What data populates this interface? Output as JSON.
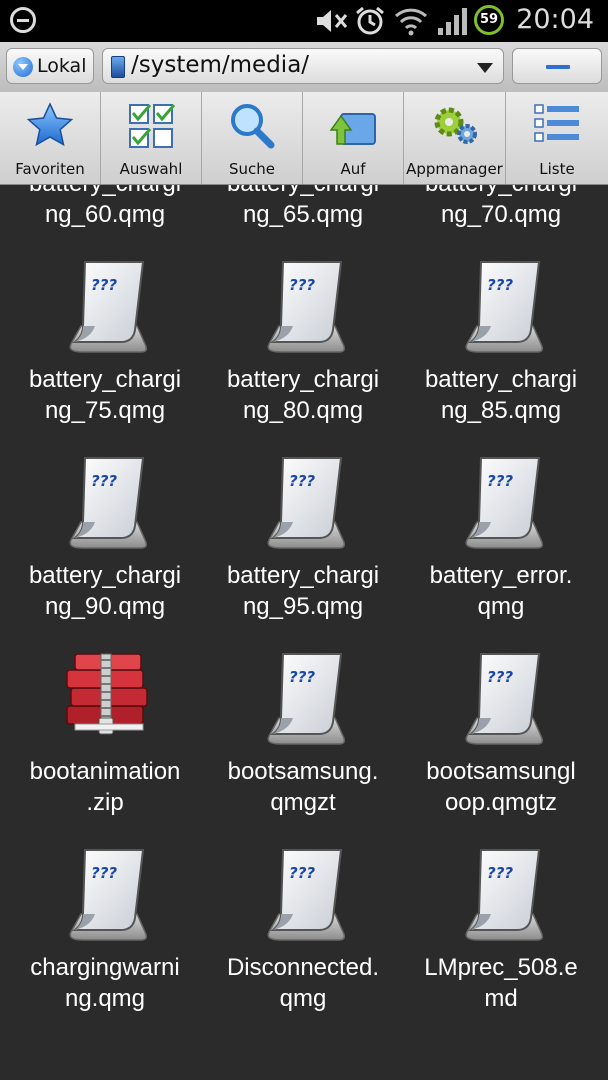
{
  "status_bar": {
    "time": "20:04",
    "battery_level": "59",
    "icons": [
      "do-not-disturb-icon",
      "mute-icon",
      "alarm-icon",
      "wifi-icon",
      "signal-icon",
      "battery-icon"
    ]
  },
  "address_bar": {
    "location_label": "Lokal",
    "path": "/system/media/"
  },
  "toolbar": {
    "items": [
      {
        "label": "Favoriten",
        "icon": "star-icon"
      },
      {
        "label": "Auswahl",
        "icon": "checklist-icon"
      },
      {
        "label": "Suche",
        "icon": "magnifier-icon"
      },
      {
        "label": "Auf",
        "icon": "folder-up-icon"
      },
      {
        "label": "Appmanager",
        "icon": "gears-icon"
      },
      {
        "label": "Liste",
        "icon": "list-view-icon"
      }
    ]
  },
  "files": [
    {
      "line1": "battery_chargi",
      "line2": "ng_60.qmg",
      "type": "unknown"
    },
    {
      "line1": "battery_chargi",
      "line2": "ng_65.qmg",
      "type": "unknown"
    },
    {
      "line1": "battery_chargi",
      "line2": "ng_70.qmg",
      "type": "unknown"
    },
    {
      "line1": "battery_chargi",
      "line2": "ng_75.qmg",
      "type": "unknown"
    },
    {
      "line1": "battery_chargi",
      "line2": "ng_80.qmg",
      "type": "unknown"
    },
    {
      "line1": "battery_chargi",
      "line2": "ng_85.qmg",
      "type": "unknown"
    },
    {
      "line1": "battery_chargi",
      "line2": "ng_90.qmg",
      "type": "unknown"
    },
    {
      "line1": "battery_chargi",
      "line2": "ng_95.qmg",
      "type": "unknown"
    },
    {
      "line1": "battery_error.",
      "line2": "qmg",
      "type": "unknown"
    },
    {
      "line1": "bootanimation",
      "line2": ".zip",
      "type": "zip"
    },
    {
      "line1": "bootsamsung.",
      "line2": "qmgzt",
      "type": "unknown"
    },
    {
      "line1": "bootsamsungl",
      "line2": "oop.qmgtz",
      "type": "unknown"
    },
    {
      "line1": "chargingwarni",
      "line2": "ng.qmg",
      "type": "unknown"
    },
    {
      "line1": "Disconnected.",
      "line2": "qmg",
      "type": "unknown"
    },
    {
      "line1": "LMprec_508.e",
      "line2": "md",
      "type": "unknown"
    }
  ],
  "colors": {
    "background": "#2b2b2b",
    "accent": "#2f6fd0"
  }
}
